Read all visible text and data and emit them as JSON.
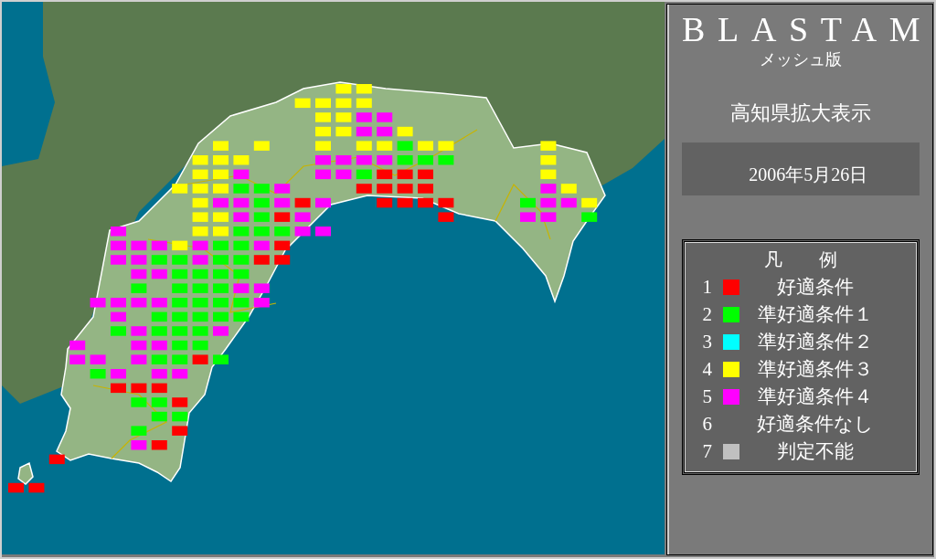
{
  "panel": {
    "title": "BLASTAM",
    "subtitle": "メッシュ版",
    "view": "高知県拡大表示",
    "date": "2006年5月26日"
  },
  "legend": {
    "title": "凡　　例",
    "items": [
      {
        "number": "1",
        "label": "好適条件",
        "color": "#ff0000"
      },
      {
        "number": "2",
        "label": "準好適条件１",
        "color": "#00ff00"
      },
      {
        "number": "3",
        "label": "準好適条件２",
        "color": "#00ffff"
      },
      {
        "number": "4",
        "label": "準好適条件３",
        "color": "#ffff00"
      },
      {
        "number": "5",
        "label": "準好適条件４",
        "color": "#ff00ff"
      },
      {
        "number": "6",
        "label": "好適条件なし"
      },
      {
        "number": "7",
        "label": "判定不能",
        "color": "#c0c0c0"
      }
    ]
  }
}
